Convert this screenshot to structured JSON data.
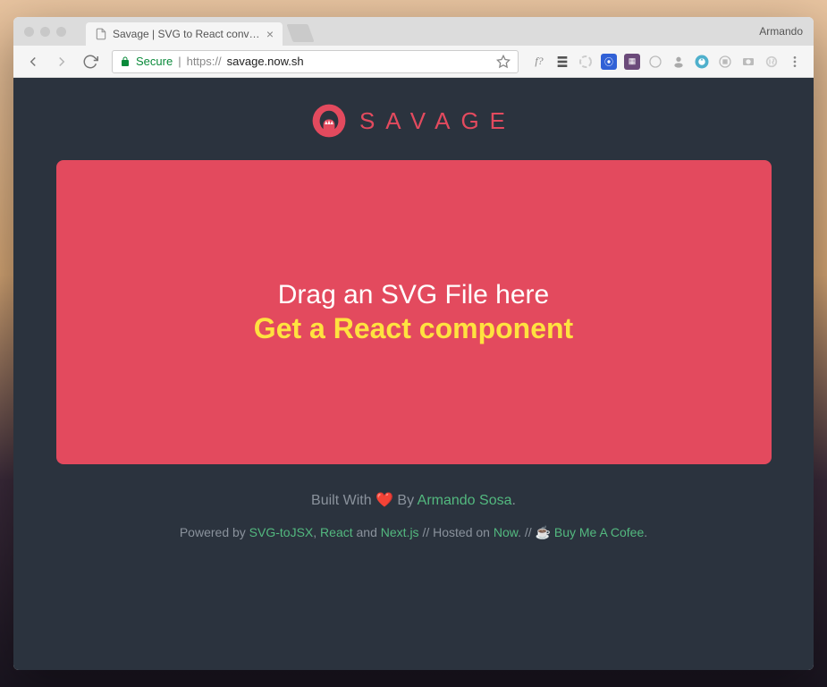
{
  "browser": {
    "profile": "Armando",
    "tab": {
      "title": "Savage | SVG to React convert"
    },
    "address": {
      "secure_label": "Secure",
      "protocol": "https://",
      "host": "savage.now.sh"
    }
  },
  "page": {
    "brand": "SAVAGE",
    "dropzone": {
      "line1": "Drag an SVG File here",
      "line2": "Get a React component"
    },
    "footer": {
      "built_with_prefix": "Built With ",
      "heart": "❤️",
      "by": " By ",
      "author": "Armando Sosa",
      "period": ".",
      "powered_prefix": "Powered by ",
      "svg_to_jsx": "SVG-toJSX",
      "comma": ", ",
      "react": "React",
      "and": " and ",
      "nextjs": "Next.js",
      "hosted_sep": " // Hosted on ",
      "now": "Now",
      "coffee_sep": ". // ",
      "coffee_icon": "☕",
      "buy_coffee": "Buy Me A Cofee",
      "end": "."
    }
  }
}
